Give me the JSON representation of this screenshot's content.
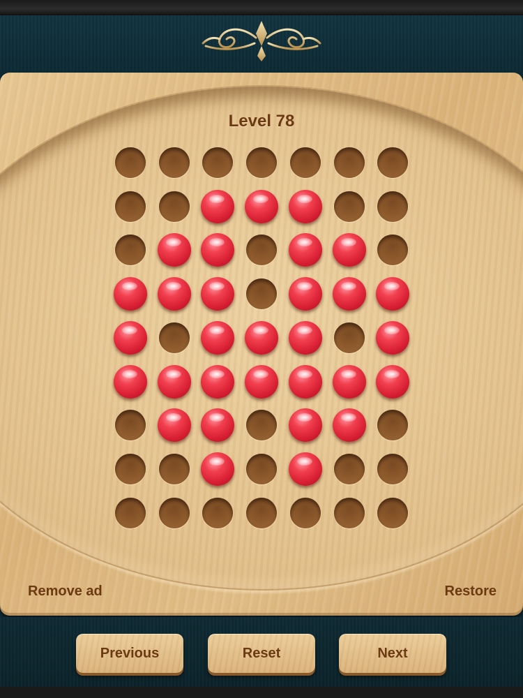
{
  "level": {
    "label": "Level 78"
  },
  "board": {
    "rows": 9,
    "cols": 7,
    "cells": [
      "0000000",
      "0011100",
      "0110110",
      "1110111",
      "1011101",
      "1111111",
      "0110110",
      "0010100",
      "0000000"
    ]
  },
  "links": {
    "remove_ad": "Remove ad",
    "restore": "Restore"
  },
  "buttons": {
    "previous": "Previous",
    "reset": "Reset",
    "next": "Next"
  },
  "colors": {
    "marble": "#e8283a",
    "wood": "#e2bf88",
    "frame": "#0f2a33",
    "text": "#6b3a12"
  },
  "icons": {
    "header": "ornament-icon"
  }
}
